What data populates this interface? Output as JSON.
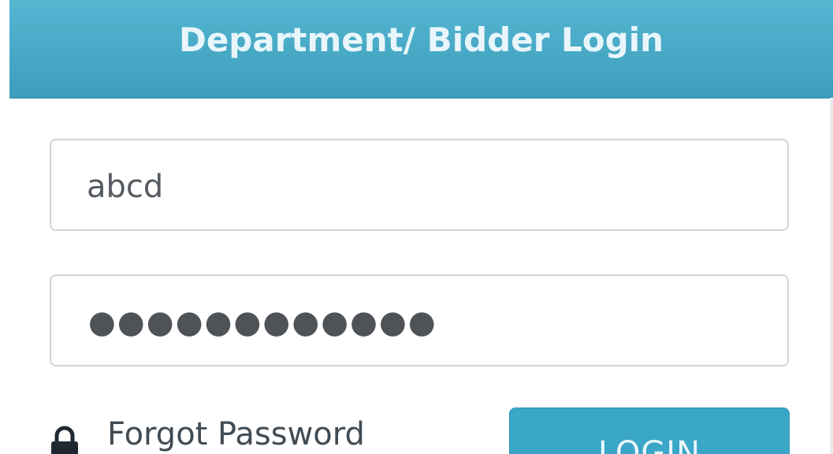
{
  "header": {
    "title": "Department/ Bidder Login"
  },
  "form": {
    "username_value": "abcd",
    "password_masked": "●●●●●●●●●●●●",
    "forgot_label": "Forgot Password",
    "login_label": "LOGIN"
  },
  "colors": {
    "header_bg": "#46a9c6",
    "header_text": "#e8f6fb",
    "button_bg": "#3aa6c8",
    "field_border": "#d3d6d8"
  },
  "icons": {
    "forgot": "lock-icon"
  }
}
